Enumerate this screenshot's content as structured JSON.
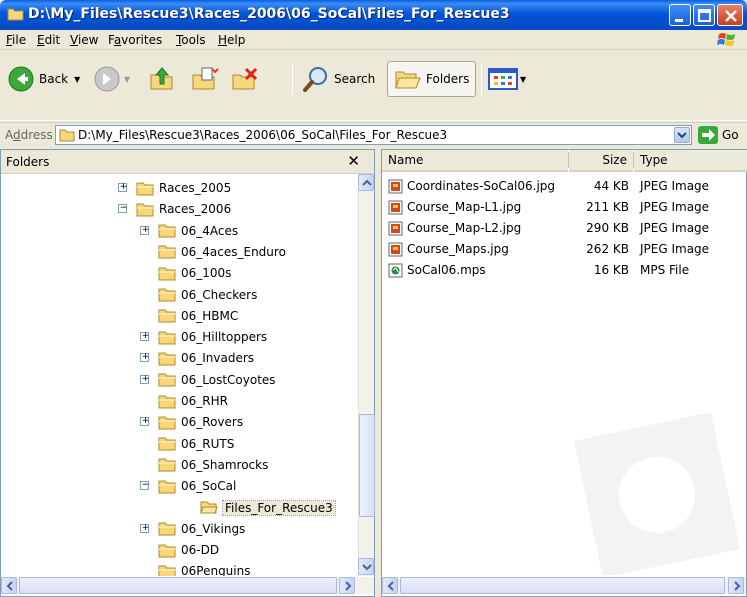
{
  "window": {
    "title": "D:\\My_Files\\Rescue3\\Races_2006\\06_SoCal\\Files_For_Rescue3"
  },
  "menu": [
    {
      "label": "File",
      "u": "F",
      "rest": "ile"
    },
    {
      "label": "Edit",
      "u": "E",
      "rest": "dit"
    },
    {
      "label": "View",
      "u": "V",
      "rest": "iew"
    },
    {
      "label": "Favorites",
      "pre": "F",
      "u": "a",
      "rest": "vorites"
    },
    {
      "label": "Tools",
      "u": "T",
      "rest": "ools"
    },
    {
      "label": "Help",
      "u": "H",
      "rest": "elp"
    }
  ],
  "toolbar": {
    "back_label": "Back",
    "search_label": "Search",
    "folders_label": "Folders"
  },
  "address": {
    "label": "Address",
    "label_underline": "d",
    "value": "D:\\My_Files\\Rescue3\\Races_2006\\06_SoCal\\Files_For_Rescue3",
    "go_label": "Go"
  },
  "folders_pane": {
    "title": "Folders",
    "close_glyph": "✕",
    "tree": [
      {
        "label": "Races_2005",
        "expander": "+"
      },
      {
        "label": "Races_2006",
        "expander": "−"
      },
      {
        "label": "06_4Aces",
        "expander": "+"
      },
      {
        "label": "06_4aces_Enduro",
        "expander": ""
      },
      {
        "label": "06_100s",
        "expander": ""
      },
      {
        "label": "06_Checkers",
        "expander": ""
      },
      {
        "label": "06_HBMC",
        "expander": ""
      },
      {
        "label": "06_Hilltoppers",
        "expander": "+"
      },
      {
        "label": "06_Invaders",
        "expander": "+"
      },
      {
        "label": "06_LostCoyotes",
        "expander": "+"
      },
      {
        "label": "06_RHR",
        "expander": ""
      },
      {
        "label": "06_Rovers",
        "expander": "+"
      },
      {
        "label": "06_RUTS",
        "expander": ""
      },
      {
        "label": "06_Shamrocks",
        "expander": ""
      },
      {
        "label": "06_SoCal",
        "expander": "−"
      },
      {
        "label": "Files_For_Rescue3",
        "expander": "",
        "selected": true,
        "open": true
      },
      {
        "label": "06_Vikings",
        "expander": "+"
      },
      {
        "label": "06-DD",
        "expander": ""
      },
      {
        "label": "06Penguins",
        "expander": ""
      }
    ]
  },
  "files_pane": {
    "columns": {
      "name": "Name",
      "size": "Size",
      "type": "Type"
    },
    "files": [
      {
        "name": "Coordinates-SoCal06.jpg",
        "size": "44 KB",
        "type": "JPEG Image",
        "icon": "jpeg-icon"
      },
      {
        "name": "Course_Map-L1.jpg",
        "size": "211 KB",
        "type": "JPEG Image",
        "icon": "jpeg-icon"
      },
      {
        "name": "Course_Map-L2.jpg",
        "size": "290 KB",
        "type": "JPEG Image",
        "icon": "jpeg-icon"
      },
      {
        "name": "Course_Maps.jpg",
        "size": "262 KB",
        "type": "JPEG Image",
        "icon": "jpeg-icon"
      },
      {
        "name": "SoCal06.mps",
        "size": "16 KB",
        "type": "MPS File",
        "icon": "mps-icon"
      }
    ]
  },
  "colors": {
    "titlebar": "#0454d8",
    "selection": "#ece9d8",
    "folder": "#f6d77a"
  }
}
